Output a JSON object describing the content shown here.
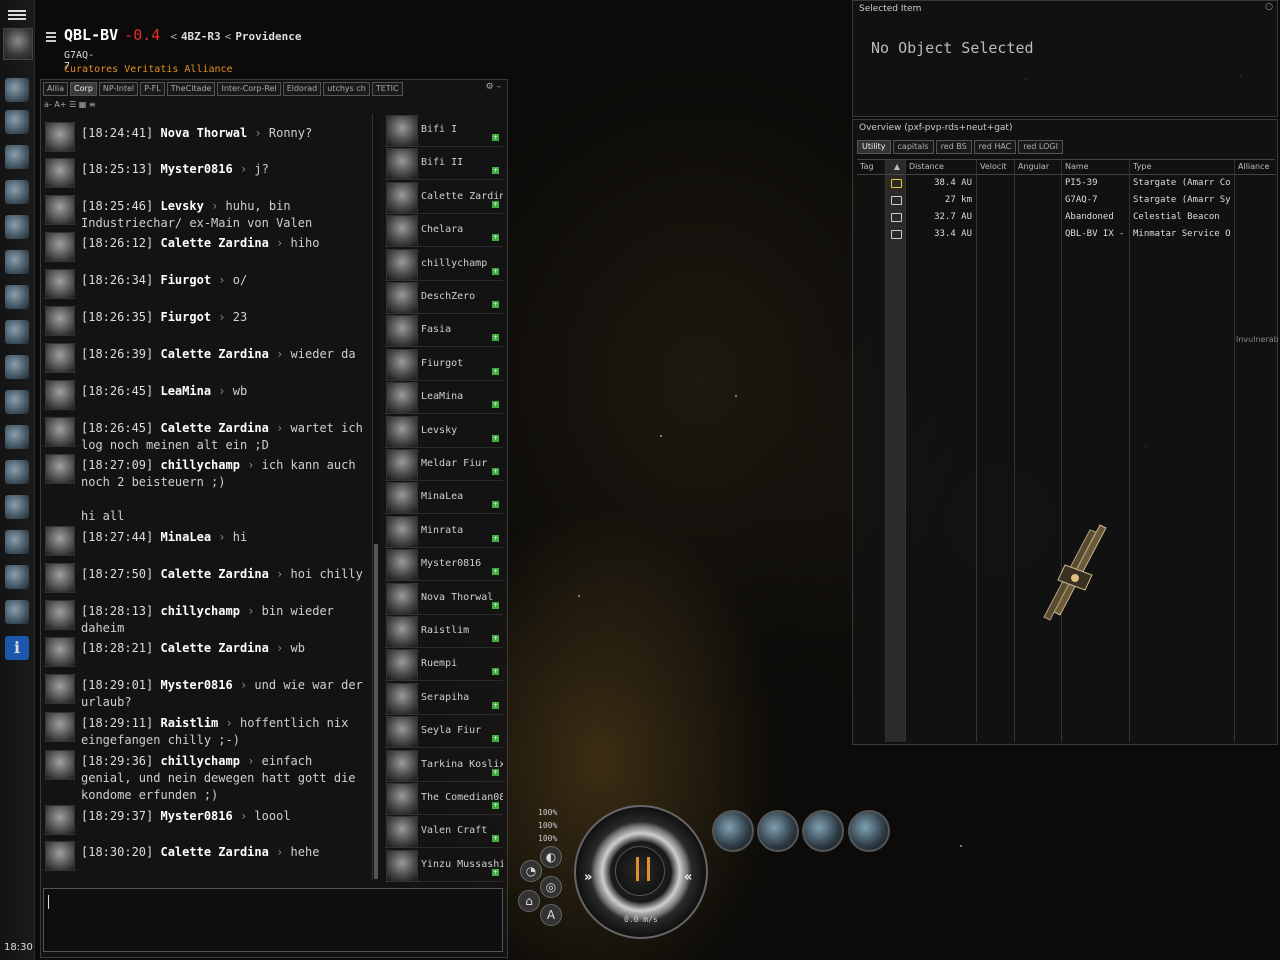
{
  "location": {
    "system": "QBL-BV",
    "security": "-0.4",
    "route": [
      "4BZ-R3",
      "Providence"
    ],
    "constellation": "G7AQ-7",
    "alliance": "Curatores Veritatis Alliance"
  },
  "clock": "18:30",
  "chat": {
    "tabs": [
      "Allia",
      "Corp",
      "NP-Intel",
      "P-FL",
      "TheCitade",
      "Inter-Corp-Rel",
      "Eldorad",
      "utchys ch",
      "TETIC"
    ],
    "active_tab": "Corp",
    "font_controls": "a- A+",
    "messages": [
      {
        "time": "[18:24:41]",
        "sender": "Nova Thorwal",
        "text": "Ronny?"
      },
      {
        "time": "[18:25:13]",
        "sender": "Myster0816",
        "text": "j?"
      },
      {
        "time": "[18:25:46]",
        "sender": "Levsky",
        "text": "huhu, bin Industriechar/ ex-Main von Valen"
      },
      {
        "time": "[18:26:12]",
        "sender": "Calette Zardina",
        "text": "hiho"
      },
      {
        "time": "[18:26:34]",
        "sender": "Fiurgot",
        "text": "o/"
      },
      {
        "time": "[18:26:35]",
        "sender": "Fiurgot",
        "text": "23"
      },
      {
        "time": "[18:26:39]",
        "sender": "Calette Zardina",
        "text": "wieder da"
      },
      {
        "time": "[18:26:45]",
        "sender": "LeaMina",
        "text": "wb"
      },
      {
        "time": "[18:26:45]",
        "sender": "Calette Zardina",
        "text": "wartet ich log noch meinen alt ein ;D"
      },
      {
        "time": "[18:27:09]",
        "sender": "chillychamp",
        "text": "ich kann auch noch 2 beisteuern ;)",
        "extra": "hi all"
      },
      {
        "time": "[18:27:44]",
        "sender": "MinaLea",
        "text": "hi"
      },
      {
        "time": "[18:27:50]",
        "sender": "Calette Zardina",
        "text": "hoi chilly"
      },
      {
        "time": "[18:28:13]",
        "sender": "chillychamp",
        "text": "bin wieder daheim"
      },
      {
        "time": "[18:28:21]",
        "sender": "Calette Zardina",
        "text": "wb"
      },
      {
        "time": "[18:29:01]",
        "sender": "Myster0816",
        "text": "und wie war der urlaub?"
      },
      {
        "time": "[18:29:11]",
        "sender": "Raistlim",
        "text": "hoffentlich nix eingefangen chilly ;-)"
      },
      {
        "time": "[18:29:36]",
        "sender": "chillychamp",
        "text": "einfach genial, und nein dewegen hatt gott die kondome erfunden ;)"
      },
      {
        "time": "[18:29:37]",
        "sender": "Myster0816",
        "text": "loool"
      },
      {
        "time": "[18:30:20]",
        "sender": "Calette Zardina",
        "text": "hehe"
      }
    ],
    "members": [
      "Bifi I",
      "Bifi II",
      "Calette Zardina",
      "Chelara",
      "chillychamp",
      "DeschZero",
      "Fasia",
      "Fiurgot",
      "LeaMina",
      "Levsky",
      "Meldar Fiur",
      "MinaLea",
      "Minrata",
      "Myster0816",
      "Nova Thorwal",
      "Raistlim",
      "Ruempi",
      "Serapiha",
      "Seyla Fiur",
      "Tarkina Koslix",
      "The Comedian08",
      "Valen Craft",
      "Yinzu Mussashi"
    ]
  },
  "selected_item": {
    "title": "Selected Item",
    "empty_text": "No Object Selected"
  },
  "overview": {
    "title": "Overview (pxf-pvp-rds+neut+gat)",
    "tabs": [
      "Utility",
      "capitals",
      "red BS",
      "red HAC",
      "red LOGI"
    ],
    "active_tab": "Utility",
    "columns": [
      "Tag",
      "",
      "Distance",
      "Velocit",
      "Angular",
      "Name",
      "Type",
      "Alliance"
    ],
    "rows": [
      {
        "icon": "stargate-icon",
        "distance": "38.4 AU",
        "name": "PI5-39",
        "type": "Stargate (Amarr Co"
      },
      {
        "icon": "stargate-icon",
        "distance": "27 km",
        "name": "G7AQ-7",
        "type": "Stargate (Amarr Sy"
      },
      {
        "icon": "beacon-icon",
        "distance": "32.7 AU",
        "name": "Abandoned",
        "type": "Celestial Beacon"
      },
      {
        "icon": "station-icon",
        "distance": "33.4 AU",
        "name": "QBL-BV IX -",
        "type": "Minmatar Service O"
      }
    ],
    "side_label": "Invulnerab"
  },
  "hud": {
    "shield": "100%",
    "armor": "100%",
    "hull": "100%",
    "speed": "0.0 m/s",
    "autopilot_label": "A"
  }
}
